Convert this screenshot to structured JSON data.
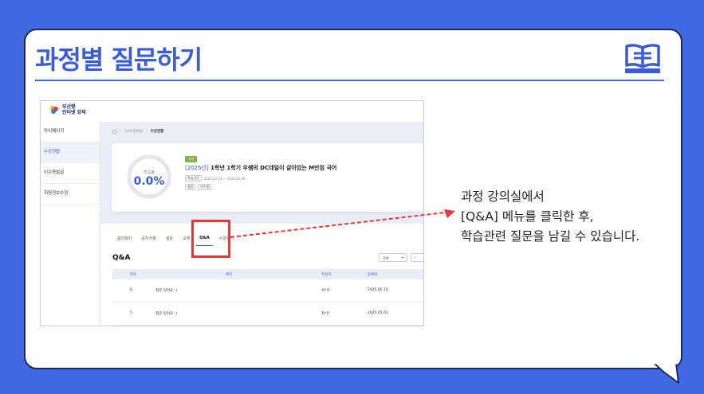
{
  "page": {
    "title": "과정별 질문하기",
    "description": [
      "과정 강의실에서",
      "[Q&A] 메뉴를 클릭한 후,",
      "학습관련 질문을 남길 수 있습니다."
    ],
    "accent_color": "#4169e1",
    "highlight_color": "#e53935",
    "icon": "book-icon"
  },
  "screenshot": {
    "logo": {
      "line1": "부산형",
      "line2": "인터넷 강의"
    },
    "sidebar": {
      "items": [
        {
          "label": "마이페이지",
          "active": false
        },
        {
          "label": "수강현황",
          "active": true
        },
        {
          "label": "이수증발급",
          "active": false
        },
        {
          "label": "회원정보수정",
          "active": false
        }
      ]
    },
    "breadcrumb": {
      "items": [
        "나의 강의실",
        "수강현황"
      ],
      "home_icon": "home-icon"
    },
    "course": {
      "progress_label": "진도율",
      "progress_value": "0.0%",
      "progress": 0,
      "badge": "국어",
      "year": "[2025년]",
      "title": "1학년 1학기 우쌤의 DC데일이 살아있는 M만점 국어",
      "period_label": "학습기간",
      "period": "2025.01.01 ~ 2026.02.28",
      "chips": [
        "중등",
        "이수중"
      ]
    },
    "tabs": [
      {
        "label": "강의목차",
        "active": false
      },
      {
        "label": "공지사항",
        "active": false
      },
      {
        "label": "설문",
        "active": false
      },
      {
        "label": "교재",
        "active": false
      },
      {
        "label": "Q&A",
        "active": true
      },
      {
        "label": "수강후기",
        "active": false
      }
    ],
    "qa": {
      "title": "Q&A",
      "filter_value": "전체",
      "columns": [
        "번호",
        "제목",
        "작성자",
        "등록일"
      ],
      "rows": [
        [
          "6",
          "질문 있어요 :)",
          "서*우",
          "2025.06.10"
        ],
        [
          "5",
          "질문 있어요 :)",
          "최*은",
          "2025.05.03"
        ]
      ]
    }
  }
}
